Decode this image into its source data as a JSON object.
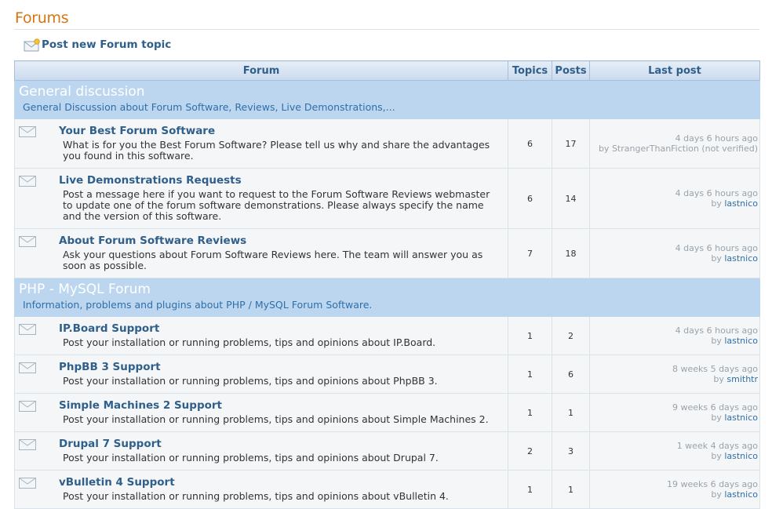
{
  "page": {
    "title": "Forums"
  },
  "actions": {
    "new_topic": "Post new Forum topic"
  },
  "table": {
    "headers": {
      "forum": "Forum",
      "topics": "Topics",
      "posts": "Posts",
      "last_post": "Last post"
    },
    "categories": [
      {
        "name": "General discussion",
        "description": "General Discussion about Forum Software, Reviews, Live Demonstrations,...",
        "forums": [
          {
            "name": "Your Best Forum Software",
            "description": "What is for you the Best Forum Software? Please tell us why and share the advantages you found in this software.",
            "topics": "6",
            "posts": "17",
            "last_time": "4 days 6 hours ago",
            "last_by_prefix": "by",
            "last_by": "StrangerThanFiction (not verified)"
          },
          {
            "name": "Live Demonstrations Requests",
            "description": "Post a message here if you want to request to the Forum Software Reviews webmaster to update one of the forum software demonstrations. Please always specify the name and the version of this software.",
            "topics": "6",
            "posts": "14",
            "last_time": "4 days 6 hours ago",
            "last_by_prefix": "by",
            "last_by": "lastnico"
          },
          {
            "name": "About Forum Software Reviews",
            "description": "Ask your questions about Forum Software Reviews here. The team will answer you as soon as possible.",
            "topics": "7",
            "posts": "18",
            "last_time": "4 days 6 hours ago",
            "last_by_prefix": "by",
            "last_by": "lastnico"
          }
        ]
      },
      {
        "name": "PHP - MySQL Forum",
        "description": "Information, problems and plugins about PHP / MySQL Forum Software.",
        "forums": [
          {
            "name": "IP.Board Support",
            "description": "Post your installation or running problems, tips and opinions about IP.Board.",
            "topics": "1",
            "posts": "2",
            "last_time": "4 days 6 hours ago",
            "last_by_prefix": "by",
            "last_by": "lastnico"
          },
          {
            "name": "PhpBB 3 Support",
            "description": "Post your installation or running problems, tips and opinions about PhpBB 3.",
            "topics": "1",
            "posts": "6",
            "last_time": "8 weeks 5 days ago",
            "last_by_prefix": "by",
            "last_by": "smithtr"
          },
          {
            "name": "Simple Machines 2 Support",
            "description": "Post your installation or running problems, tips and opinions about Simple Machines 2.",
            "topics": "1",
            "posts": "1",
            "last_time": "9 weeks 6 days ago",
            "last_by_prefix": "by",
            "last_by": "lastnico"
          },
          {
            "name": "Drupal 7 Support",
            "description": "Post your installation or running problems, tips and opinions about Drupal 7.",
            "topics": "2",
            "posts": "3",
            "last_time": "1 week 4 days ago",
            "last_by_prefix": "by",
            "last_by": "lastnico"
          },
          {
            "name": "vBulletin 4 Support",
            "description": "Post your installation or running problems, tips and opinions about vBulletin 4.",
            "topics": "1",
            "posts": "1",
            "last_time": "19 weeks 6 days ago",
            "last_by_prefix": "by",
            "last_by": "lastnico"
          }
        ]
      }
    ]
  },
  "icons": {
    "forum": "envelope-icon",
    "new_topic": "new-post-envelope-icon"
  },
  "colors": {
    "title": "#d9750e",
    "link": "#2f5f8a",
    "category_bg": "#bcd6f0",
    "row_bg": "#f4f6f7"
  }
}
